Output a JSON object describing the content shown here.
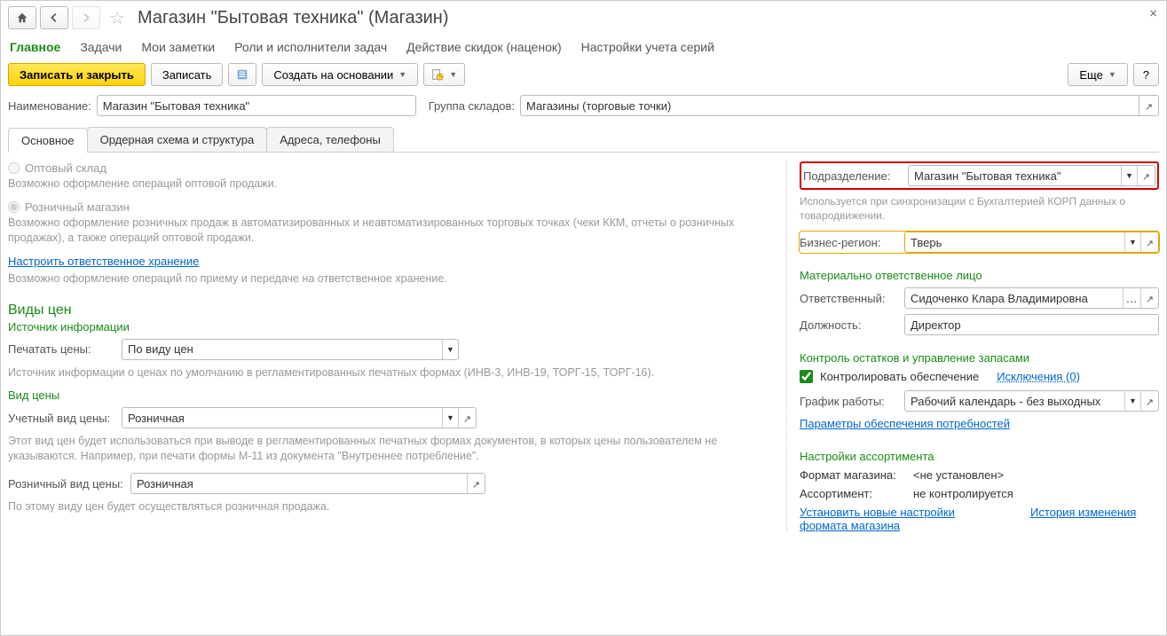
{
  "header": {
    "title": "Магазин \"Бытовая техника\"  (Магазин)"
  },
  "upper_tabs": [
    "Главное",
    "Задачи",
    "Мои заметки",
    "Роли и исполнители задач",
    "Действие скидок (наценок)",
    "Настройки учета серий"
  ],
  "toolbar": {
    "save_close": "Записать и закрыть",
    "save": "Записать",
    "create_based": "Создать на основании",
    "more": "Еще",
    "help": "?"
  },
  "name_field": {
    "label": "Наименование:",
    "value": "Магазин \"Бытовая техника\""
  },
  "group_field": {
    "label": "Группа складов:",
    "value": "Магазины (торговые точки)"
  },
  "inner_tabs": [
    "Основное",
    "Ордерная схема и структура",
    "Адреса, телефоны"
  ],
  "left": {
    "wholesale_radio": "Оптовый склад",
    "wholesale_note": "Возможно оформление операций оптовой продажи.",
    "retail_radio": "Розничный магазин",
    "retail_note": "Возможно оформление розничных продаж в автоматизированных и неавтоматизированных торговых точках (чеки ККМ, отчеты о розничных продажах), а также операций оптовой продажи.",
    "storage_link": "Настроить ответственное хранение",
    "storage_note": "Возможно оформление операций по приему и передаче на ответственное хранение.",
    "prices_section": "Виды цен",
    "source_sub": "Источник информации",
    "print_prices_lbl": "Печатать цены:",
    "print_prices_val": "По виду цен",
    "source_note": "Источник информации о ценах по умолчанию в регламентированных печатных формах (ИНВ-3, ИНВ-19, ТОРГ-15, ТОРГ-16).",
    "price_type_sub": "Вид цены",
    "acct_price_lbl": "Учетный вид цены:",
    "acct_price_val": "Розничная",
    "acct_price_note": "Этот вид цен будет использоваться при выводе в регламентированных печатных формах документов, в которых цены пользователем не указываются. Например, при печати формы М-11 из документа \"Внутреннее потребление\".",
    "retail_price_lbl": "Розничный вид цены:",
    "retail_price_val": "Розничная",
    "retail_price_note": "По этому виду цен будет осуществляться розничная продажа."
  },
  "right": {
    "division_lbl": "Подразделение:",
    "division_val": "Магазин \"Бытовая техника\"",
    "division_note": "Используется при синхронизации с Бухгалтерией КОРП данных о товародвижении.",
    "region_lbl": "Бизнес-регион:",
    "region_val": "Тверь",
    "responsible_section": "Материально ответственное лицо",
    "responsible_lbl": "Ответственный:",
    "responsible_val": "Сидоченко Клара Владимировна",
    "position_lbl": "Должность:",
    "position_val": "Директор",
    "stock_section": "Контроль остатков и управление запасами",
    "control_check": "Контролировать обеспечение",
    "exceptions_link": "Исключения (0)",
    "schedule_lbl": "График работы:",
    "schedule_val": "Рабочий календарь - без выходных",
    "params_link": "Параметры обеспечения потребностей",
    "assort_section": "Настройки ассортимента",
    "format_lbl": "Формат магазина:",
    "format_val": "<не установлен>",
    "assort_lbl": "Ассортимент:",
    "assort_val": "не контролируется",
    "set_format_link": "Установить новые настройки формата магазина",
    "history_link": "История изменения"
  }
}
